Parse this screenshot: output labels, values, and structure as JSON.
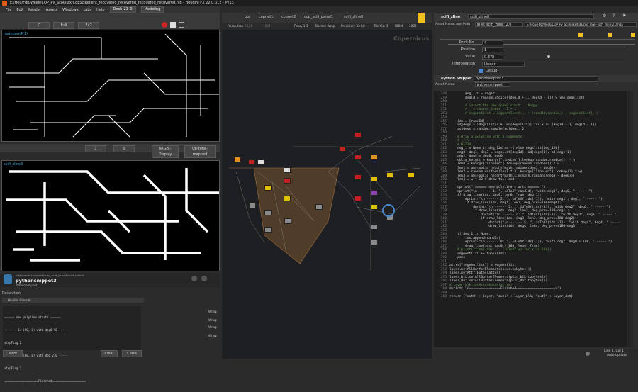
{
  "window": {
    "title": "E:/Hou/Fdb/Week/COP_Py_SciRelax/CopSciRellent_recovered_recovered_recovered_recovered.hip - Houdini FX 22.0.312 - Py13"
  },
  "menu": [
    "File",
    "Edit",
    "Render",
    "Assets",
    "Windows",
    "Labs",
    "Help"
  ],
  "desk": {
    "name": "Desk_21_0",
    "mode": "Modeling"
  },
  "viewer": {
    "res": "Full",
    "grid": "2x2",
    "letter": "C",
    "top_label": "mainnum4(1)",
    "bottom_label": "scifi_zline3",
    "zoom": "1",
    "frame": "0",
    "display": "sRGB - Display",
    "tone": "Un-tone-mapped"
  },
  "node_info": {
    "path": "/obj/copnet1/copnet2/cop_scifi_panel1/scifi_zline8/",
    "name": "pythonsnippet3",
    "type": "Python Snippet",
    "type_full": "pythonsnippet"
  },
  "console": {
    "section": "Resolution",
    "title": "Houdini Console",
    "lines": [
      "====== new polyline starts ======",
      "------- 1: (60, 0) with deg0 90 -----",
      "stepFlag 2",
      "------- 6: (60, 0) with deg 270 -----",
      "stepFlag 2",
      "====================Finished===================="
    ],
    "wraps": [
      "Wrap",
      "Wrap",
      "Wrap",
      "Wrap"
    ],
    "buttons": {
      "mark": "Mark",
      "clear": "Clear",
      "close": "Close"
    }
  },
  "network": {
    "path": [
      "obj",
      "copnet1",
      "copnet2",
      "cop_scifi_panel1",
      "scifi_zline8"
    ],
    "toolbar": {
      "res": "Resolution",
      "w": "1024",
      "h": "1024",
      "proxy": "Proxy 1:1",
      "border": "Border: Wrap",
      "precision": "Precision: 32-bit",
      "tile": "Tile Viz: 3",
      "udim": "UDIM",
      "udimval": "1001"
    },
    "watermark": "Copernicus"
  },
  "params": {
    "tab": "scifi_zline",
    "node_name": "scifi_zline8",
    "asset_label": "Asset Name and Path",
    "asset_name": "leiw::scifi_zline::2.0",
    "asset_path": "E:/Hou/Fdb/Week/COP_Py_SciRelax/hda/cop_leiw--scifi_zline-2.0.hda",
    "rows": [
      {
        "label": "Point No.",
        "value": "4"
      },
      {
        "label": "Position",
        "value": "1"
      },
      {
        "label": "Value",
        "value": "0.378"
      },
      {
        "label": "Interpolation",
        "value": "Linear"
      }
    ],
    "debug": "Debug",
    "snippet_label": "Python Snippet",
    "snippet_value": "pythonsnippet3",
    "asset2_label": "Asset Name",
    "asset2_value": "pythonsnippet",
    "status": "Line 1, Col 1",
    "auto": "Auto Update"
  },
  "code": {
    "start": 248,
    "lines": [
      "        deg_12d = deg1d",
      "        degld = random.choice([degld + 1, degld - 1]) % len(degslist)",
      "",
      "        # insert the new spawn start    buggy",
      "        # _ = chosen_index * 2 + 1",
      "        # segmentlist = segmentlist[:_] + (randId,randId,) + segmentlist[_:]",
      "",
      "    ids = [randId]",
      "    adjdegs = [degslist[x % len(degslist)] for x in [degId + 1, degId - 1]]",
      "    adjdegs = random.sample(adjdegs, 2)",
      "",
      "    # draw a polyline with 5 segments:",
      "    # _/_\\",
      "    # 01234",
      "    deg_1 = None if deg_12d == -1 else degslist[deg_12d]",
      "    deg0, deg1, deg3 = degslist[degId], adjdegs[0], adjdegs[1]",
      "    deg2, deg4 = deg0, deg0",
      "    oblig_height = kwargs[\"lineLen\"].lookup(random.random()) * h",
      "    len0 = kwargs[\"lineLen\"].lookup(random.random()) * w",
      "    len1 = abs(oblig_height/math.radians(deg1 - deg0)))",
      "    len2 = random.uniform(len1 * 3, kwargs[\"lineLen\"].lookup(1) * w)",
      "    len3 = abs(oblig_height/math.sin(math.radians(deg3 - deg0)))",
      "    len4 = w * 10 # draw till end",
      "",
      "    dprint(\" ====== new polyline starts ====== \")",
      "    dprint(\"\\n ------ 1: \", idToXY(randId), \"with deg0\", deg0, \" ----- \")",
      "    if draw_line(ids, deg0, len0, True, deg_1):",
      "        dprint(\"\\n ------ 2: \", idToXY(ids[-1]), \"with deg1\", deg1, \" ----- \")",
      "        if draw_line(ids, deg1, len1, deg_prev=180+deg0):",
      "            dprint(\"\\n ------ 3: \", idToXY(ids[-1]), \"with deg2\", deg2, \" ----- \")",
      "            if draw_line(ids, deg2, len2, deg_prev=180+deg1):",
      "                dprint(\"\\n ------ 4: \", idToXY(ids[-1]), \"with deg3\", deg3, \" ----- \")",
      "                if draw_line(ids, deg3, len3, deg_prev=180+deg2):",
      "                    dprint(\"\\n ------ 5: \", idToXY(ids[-1]), \"with deg4\", deg4, \" -----",
      "                    draw_line(ids, deg4, len4, deg_prev=180+deg3)",
      "",
      "    if deg_1 is None:",
      "        ids.append(randId)",
      "        dprint(\"\\n ------ 0: \", idToXY(ids[-1]), \"with deg\", deg0 + 180, \" ----- \")",
      "        draw_line(ids, deg0 + 180, len4, True)",
      "    # print(\"final ids: \", [idToXY(x) for x in ids])",
      "    segmentlist += tuple(ids)",
      "    pass",
      "",
      "attrs[\"segmentlist\"] = segmentlist",
      "layer.setAllBufferElements(pixs.tobytes())",
      "layer.setAttributes(attrs)",
      "layer_blk.setAllBufferElements(pixs_blk.tobytes())",
      "layer_dot.setAllBufferElements(pixs_dot.tobytes())",
      "# layer_blk.setAttributes(attrs)",
      "dprint('\\n================Finished===================\\n')",
      "",
      "return {\"out0\" : layer, \"out1\" : layer_blk, \"out2\" : layer_dot}"
    ]
  },
  "colors": {
    "accent": "#f0c020",
    "select": "#4a8ad0",
    "node_red": "#c02020",
    "node_yellow": "#e0c000",
    "node_gray": "#8a8a8a",
    "backdrop": "#7a5530"
  }
}
